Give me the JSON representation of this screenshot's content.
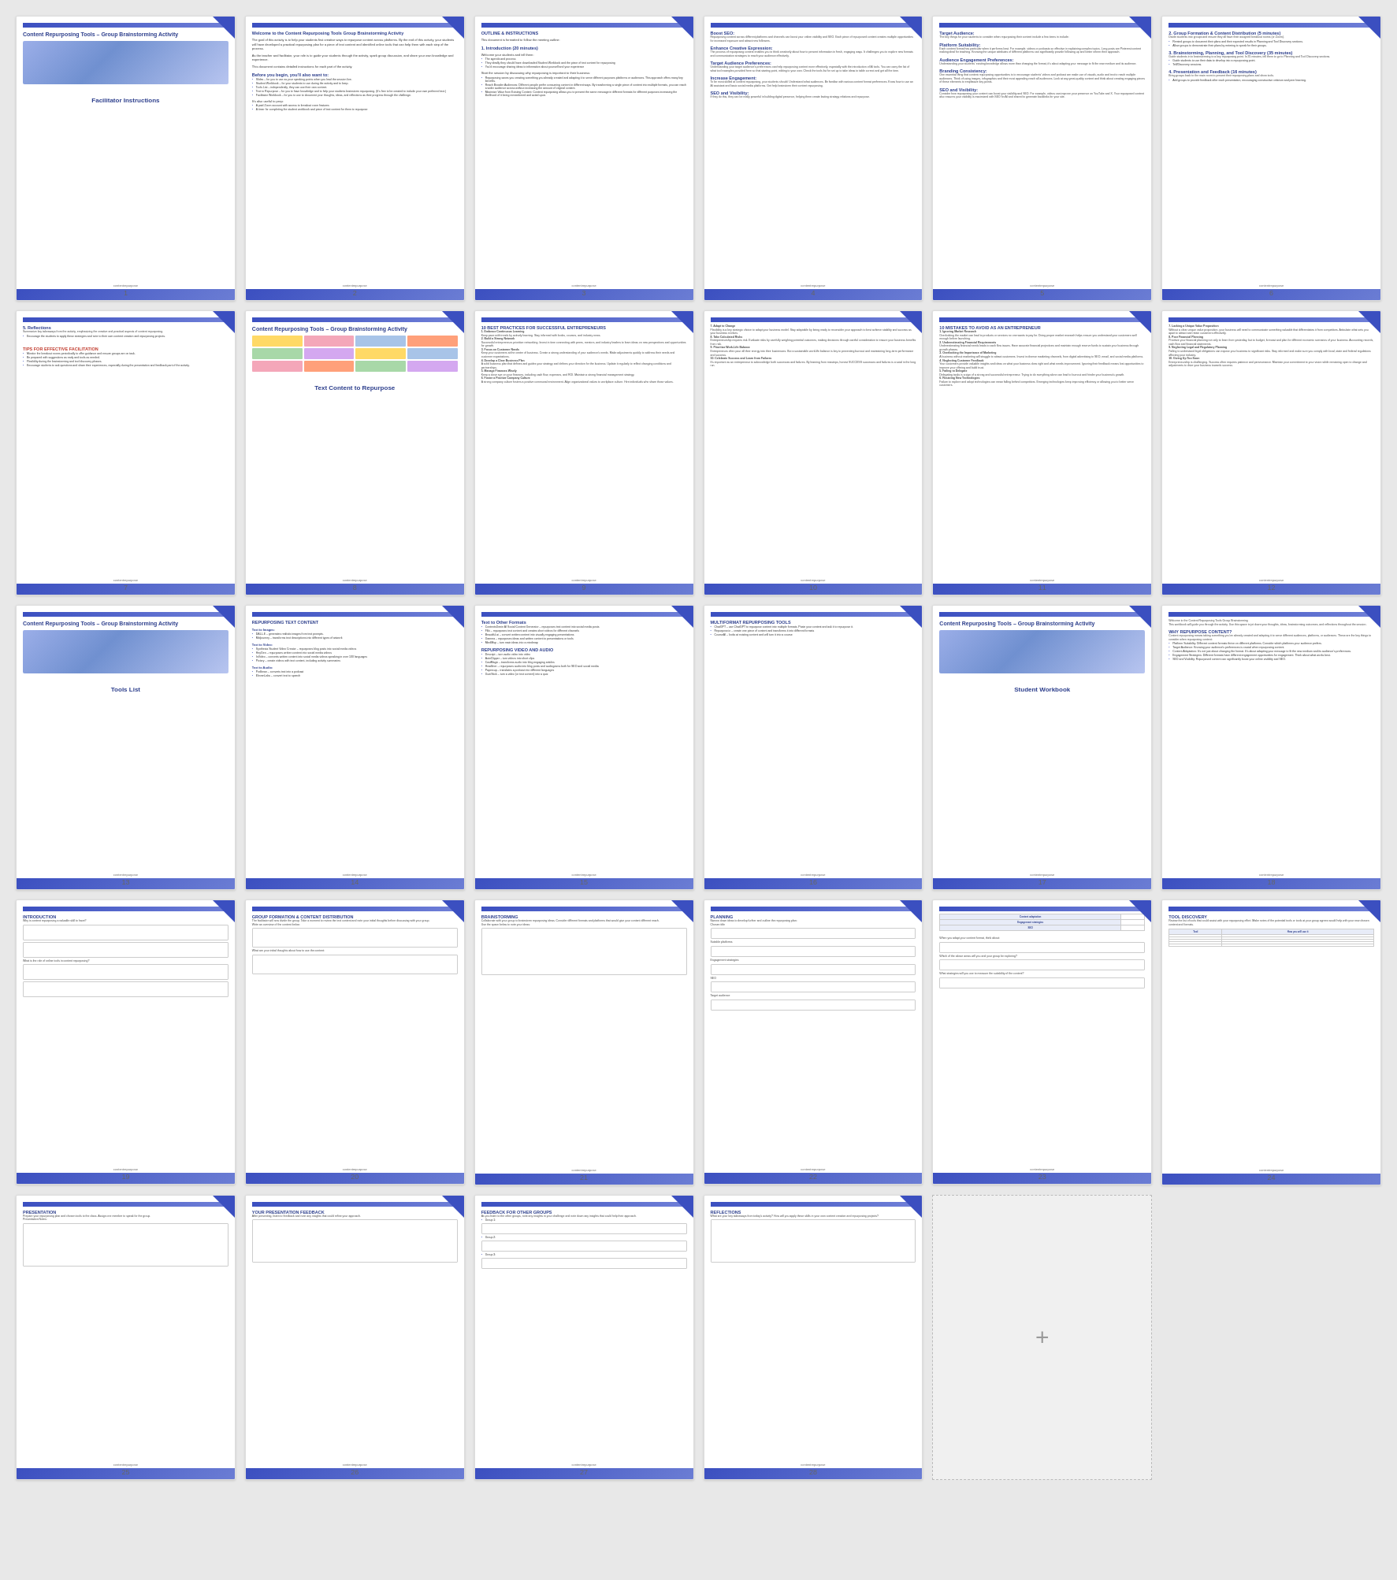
{
  "title": "Content Repurposing Tools - Group Brainstorming Activity",
  "pages": [
    {
      "id": 1,
      "number": 1,
      "type": "cover-facilitator",
      "title": "Content Repurposing Tools – Group Brainstorming Activity",
      "subtitle": "Facilitator Instructions",
      "has_image": true,
      "has_corner": true
    },
    {
      "id": 2,
      "number": 2,
      "type": "text-content",
      "title": "Welcome to the Content Repurposing Tools Group Brainstorming Activity",
      "has_corner": true
    },
    {
      "id": 3,
      "number": 3,
      "type": "outline",
      "title": "OUTLINE & INSTRUCTIONS",
      "section": "1. Introduction (20 minutes)",
      "has_corner": true
    },
    {
      "id": 4,
      "number": 4,
      "type": "text-dense",
      "title": "",
      "has_corner": true
    },
    {
      "id": 5,
      "number": 5,
      "type": "text-dense",
      "title": "",
      "has_corner": true
    },
    {
      "id": 6,
      "number": 6,
      "type": "text-dense",
      "title": "",
      "has_corner": true
    },
    {
      "id": 7,
      "number": 7,
      "type": "reflections",
      "title": "5. Reflections",
      "tips_title": "TIPS FOR EFFECTIVE FACILITATION",
      "has_corner": true
    },
    {
      "id": 8,
      "number": 8,
      "type": "cover-text",
      "title": "Content Repurposing Tools – Group Brainstorming Activity",
      "subtitle": "Text Content to Repurpose",
      "has_image": true,
      "has_corner": true
    },
    {
      "id": 9,
      "number": 9,
      "type": "best-practices",
      "title": "10 BEST PRACTICES FOR SUCCESSFUL ENTREPRENEURS",
      "has_corner": true
    },
    {
      "id": 10,
      "number": 10,
      "type": "entrepreneurs-cont",
      "title": "",
      "has_corner": true
    },
    {
      "id": 11,
      "number": 11,
      "type": "mistakes",
      "title": "10 MISTAKES TO AVOID AS AN ENTREPRENEUR",
      "has_corner": true
    },
    {
      "id": 12,
      "number": 12,
      "type": "mistakes-cont",
      "title": "",
      "has_corner": true
    },
    {
      "id": 13,
      "number": 13,
      "type": "cover-tools",
      "title": "Content Repurposing Tools – Group Brainstorming Activity",
      "subtitle": "Tools List",
      "has_image": true,
      "has_corner": true
    },
    {
      "id": 14,
      "number": 14,
      "type": "repurposing-text",
      "title": "REPURPOSING TEXT CONTENT",
      "has_corner": true
    },
    {
      "id": 15,
      "number": 15,
      "type": "other-formats",
      "title": "Text to Other Formats",
      "has_corner": true
    },
    {
      "id": 16,
      "number": 16,
      "type": "multiformat",
      "title": "MULTIFORMAT REPURPOSING TOOLS",
      "has_corner": true
    },
    {
      "id": 17,
      "number": 17,
      "type": "cover-workbook",
      "title": "Content Repurposing Tools – Group Brainstorming Activity",
      "subtitle": "Student Workbook",
      "has_image": true,
      "has_corner": true
    },
    {
      "id": 18,
      "number": 18,
      "type": "why-repurpose",
      "title": "Welcome to the Content Repurposing Tools Group Brainstorming",
      "why_title": "WHY REPURPOSE CONTENT?",
      "has_corner": true
    },
    {
      "id": 19,
      "number": 19,
      "type": "introduction-wb",
      "title": "INTRODUCTION",
      "has_corner": true
    },
    {
      "id": 20,
      "number": 20,
      "type": "group-formation",
      "title": "GROUP FORMATION & CONTENT DISTRIBUTION",
      "has_corner": true
    },
    {
      "id": 21,
      "number": 21,
      "type": "brainstorming",
      "title": "BRAINSTORMING",
      "has_corner": true
    },
    {
      "id": 22,
      "number": 22,
      "type": "planning",
      "title": "PLANNING",
      "has_corner": true
    },
    {
      "id": 23,
      "number": 23,
      "type": "planning-grid",
      "title": "",
      "has_corner": true
    },
    {
      "id": 24,
      "number": 24,
      "type": "tool-discovery",
      "title": "TOOL DISCOVERY",
      "has_corner": true
    },
    {
      "id": 25,
      "number": 25,
      "type": "presentation",
      "title": "PRESENTATION",
      "has_corner": true
    },
    {
      "id": 26,
      "number": 26,
      "type": "partner-feedback",
      "title": "YOUR PRESENTATION FEEDBACK",
      "has_corner": true
    },
    {
      "id": 27,
      "number": 27,
      "type": "group-feedback",
      "title": "FEEDBACK FOR OTHER GROUPS",
      "has_corner": true
    },
    {
      "id": 28,
      "number": 28,
      "type": "reflections-wb",
      "title": "REFLECTIONS",
      "has_corner": true
    }
  ],
  "colors": {
    "primary": "#3b4fc0",
    "secondary": "#7080d8",
    "accent": "#ffd966",
    "background": "#e8e8e8",
    "card": "#ffffff"
  },
  "logo_text": "contentrepurpose",
  "add_page_label": "+"
}
